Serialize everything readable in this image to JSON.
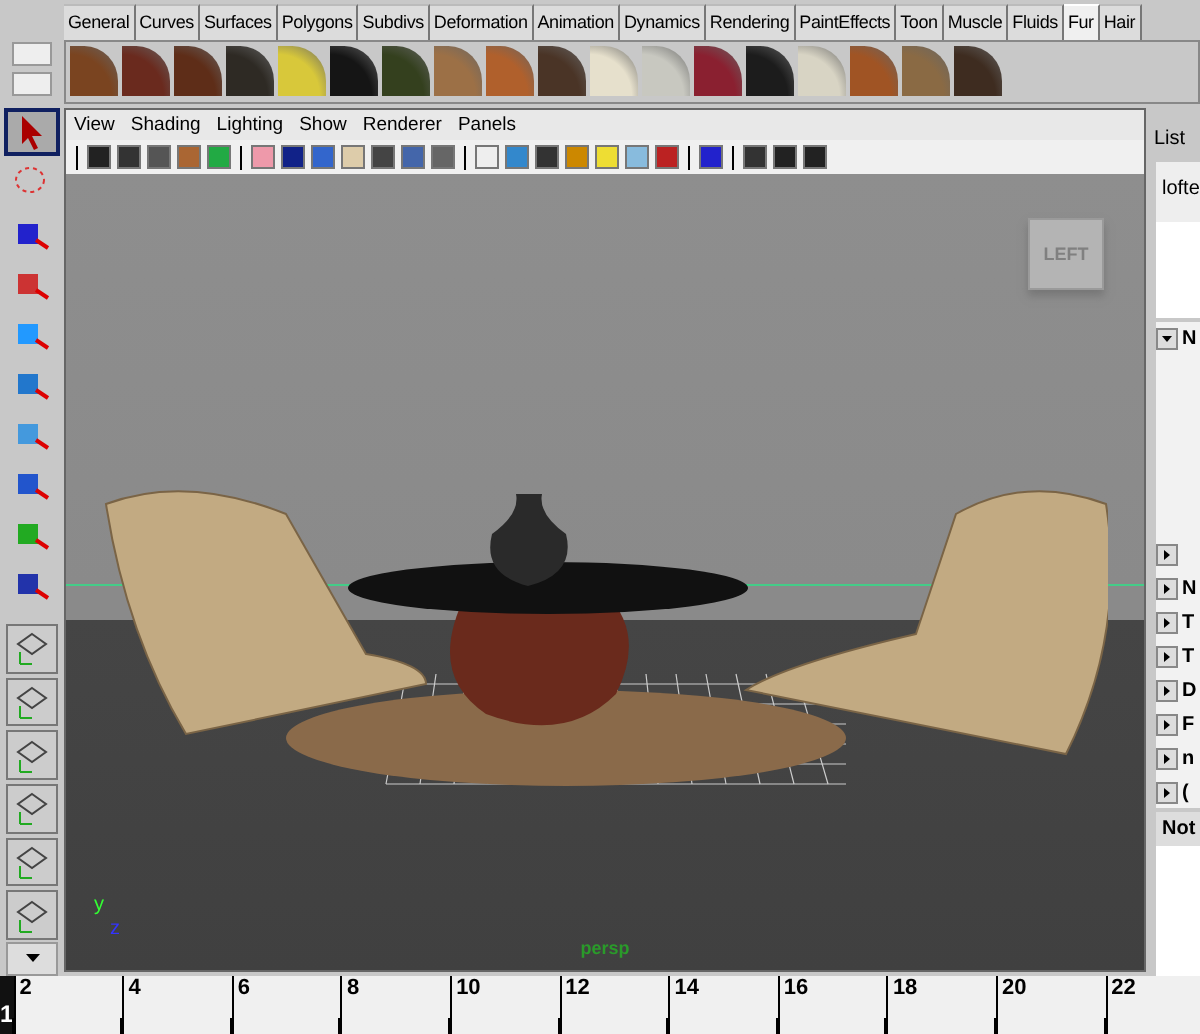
{
  "shelf": {
    "tabs": [
      {
        "label": "General",
        "selected": false
      },
      {
        "label": "Curves",
        "selected": false
      },
      {
        "label": "Surfaces",
        "selected": false
      },
      {
        "label": "Polygons",
        "selected": false
      },
      {
        "label": "Subdivs",
        "selected": false
      },
      {
        "label": "Deformation",
        "selected": false
      },
      {
        "label": "Animation",
        "selected": false
      },
      {
        "label": "Dynamics",
        "selected": false
      },
      {
        "label": "Rendering",
        "selected": false
      },
      {
        "label": "PaintEffects",
        "selected": false
      },
      {
        "label": "Toon",
        "selected": false
      },
      {
        "label": "Muscle",
        "selected": false
      },
      {
        "label": "Fluids",
        "selected": false
      },
      {
        "label": "Fur",
        "selected": true
      },
      {
        "label": "Hair",
        "selected": false
      }
    ],
    "swatches": [
      {
        "color": "#7a4420"
      },
      {
        "color": "#6a2a1e"
      },
      {
        "color": "#5e2d18"
      },
      {
        "color": "#2e2a24"
      },
      {
        "color": "#d8c83a"
      },
      {
        "color": "#151515"
      },
      {
        "color": "#34401e"
      },
      {
        "color": "#9c7046"
      },
      {
        "color": "#b0602c"
      },
      {
        "color": "#4a3426"
      },
      {
        "color": "#e6e0cc"
      },
      {
        "color": "#c8c8c0"
      },
      {
        "color": "#8a2030"
      },
      {
        "color": "#1c1c1c"
      },
      {
        "color": "#d8d4c4"
      },
      {
        "color": "#a05424"
      },
      {
        "color": "#8a6a44"
      },
      {
        "color": "#3e2c20"
      }
    ]
  },
  "tools": [
    {
      "selected": true
    },
    {
      "selected": false
    },
    {
      "selected": false
    },
    {
      "selected": false
    },
    {
      "selected": false
    },
    {
      "selected": false
    },
    {
      "selected": false
    },
    {
      "selected": false
    },
    {
      "selected": false
    },
    {
      "selected": false
    }
  ],
  "panel_menu": [
    "View",
    "Shading",
    "Lighting",
    "Show",
    "Renderer",
    "Panels"
  ],
  "viewport": {
    "view_cube": "LEFT",
    "camera": "persp",
    "axis_y": "y",
    "axis_z": "z"
  },
  "channel_box": {
    "menu": [
      "List"
    ],
    "object": "lofte",
    "header": {
      "label": "N",
      "expanded": true
    },
    "rows": [
      {
        "label": ""
      },
      {
        "label": "N"
      },
      {
        "label": "T"
      },
      {
        "label": "T"
      },
      {
        "label": "D"
      },
      {
        "label": "F"
      },
      {
        "label": "n"
      },
      {
        "label": "("
      }
    ],
    "notes": "Not"
  },
  "timeline": {
    "current": "1",
    "ticks": [
      "2",
      "4",
      "6",
      "8",
      "10",
      "12",
      "14",
      "16",
      "18",
      "20",
      "22"
    ]
  }
}
